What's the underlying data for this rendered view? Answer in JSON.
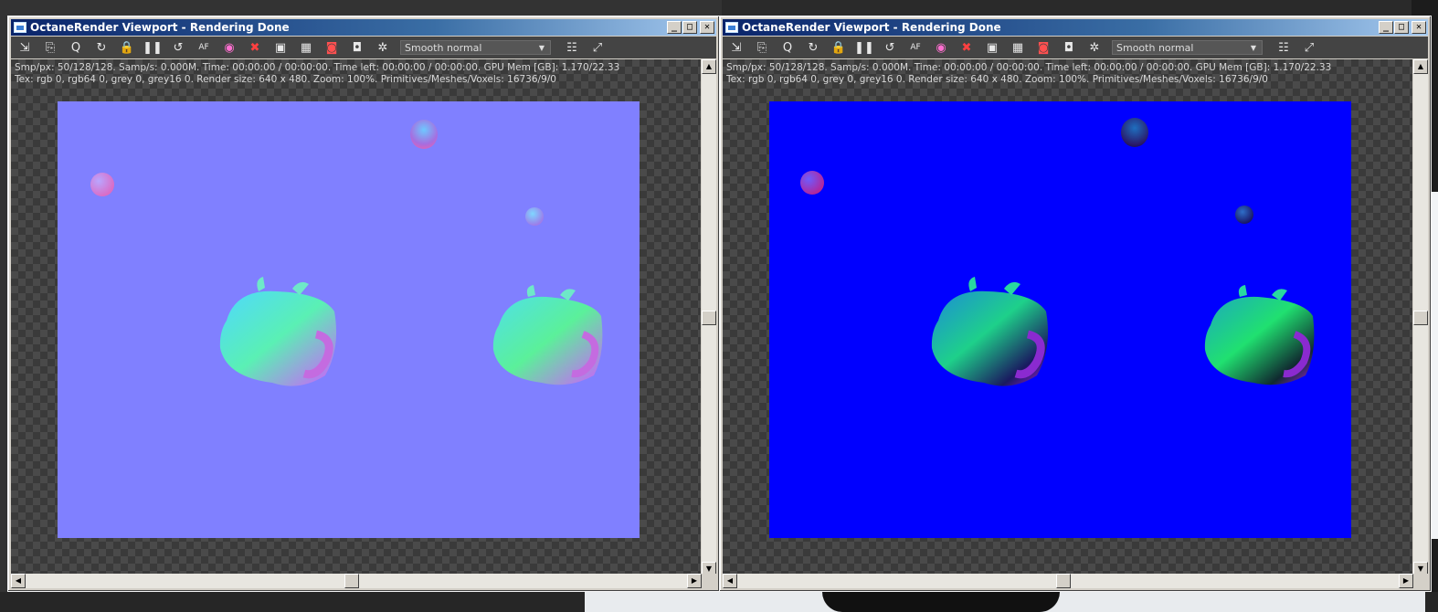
{
  "windows": [
    {
      "title": "OctaneRender Viewport - Rendering Done",
      "shading_mode": "Smooth normal",
      "stats_line1": "Smp/px: 50/128/128.   Samp/s: 0.000M.   Time: 00:00:00 / 00:00:00.   Time left: 00:00:00 / 00:00:00.   GPU Mem [GB]: 1.170/22.33",
      "stats_line2": "Tex: rgb 0, rgb64 0, grey 0, grey16 0.   Render size: 640 x 480.   Zoom: 100%.   Primitives/Meshes/Voxels: 16736/9/0",
      "render_background": "#8080ff"
    },
    {
      "title": "OctaneRender Viewport - Rendering Done",
      "shading_mode": "Smooth normal",
      "stats_line1": "Smp/px: 50/128/128.   Samp/s: 0.000M.   Time: 00:00:00 / 00:00:00.   Time left: 00:00:00 / 00:00:00.   GPU Mem [GB]: 1.170/22.33",
      "stats_line2": "Tex: rgb 0, rgb64 0, grey 0, grey16 0.   Render size: 640 x 480.   Zoom: 100%.   Primitives/Meshes/Voxels: 16736/9/0",
      "render_background": "#0000ff"
    }
  ],
  "titlebar_buttons": {
    "minimize": "_",
    "maximize": "□",
    "close": "✕"
  },
  "toolbar_icons": [
    "export-icon",
    "copy-icon",
    "zoom-icon",
    "refresh-icon",
    "lock-icon",
    "pause-icon",
    "restart-icon",
    "autofocus-icon",
    "color-picker-icon",
    "clay-mode-icon",
    "region-render-icon",
    "film-region-icon",
    "camera-icon",
    "lens-icon",
    "settings-icon"
  ],
  "toolbar_glyphs": [
    "⇲",
    "⎘",
    "Q",
    "↻",
    "🔒",
    "❚❚",
    "↺",
    "AF",
    "◉",
    "✖",
    "▣",
    "▦",
    "◙",
    "◘",
    "✲"
  ],
  "right_icons": [
    "settings-list-icon",
    "fit-view-icon"
  ],
  "right_glyphs": [
    "☷",
    "⤢"
  ]
}
